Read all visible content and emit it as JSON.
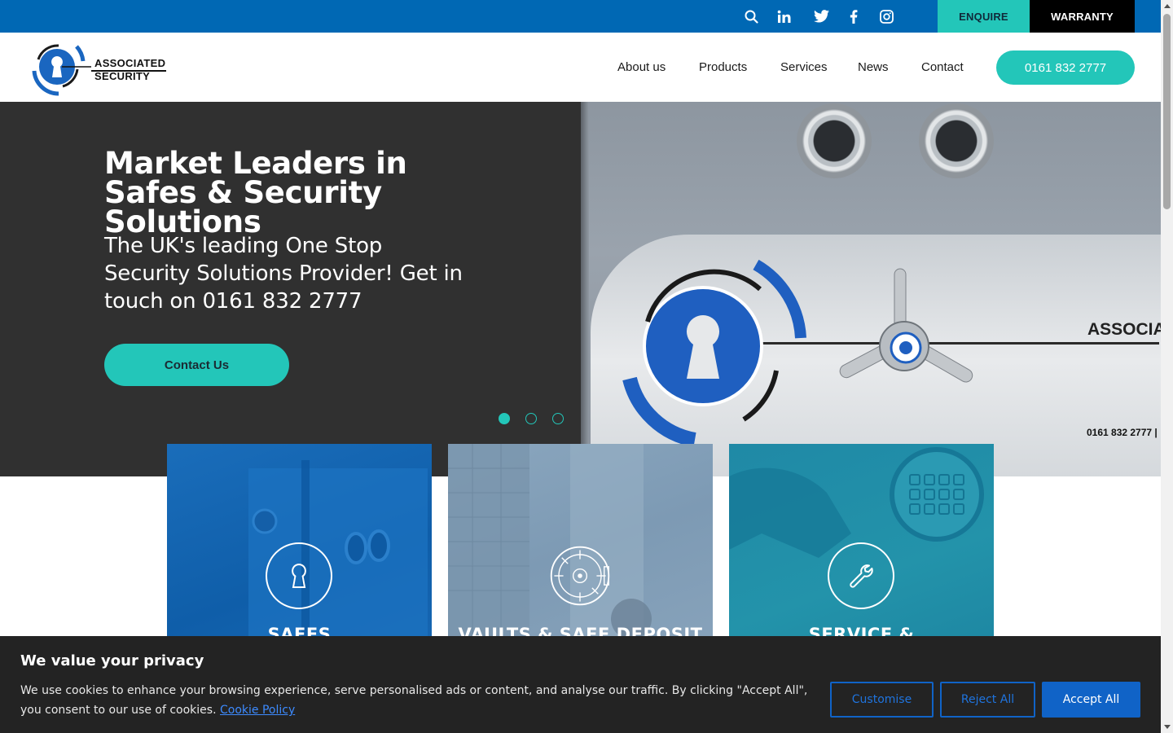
{
  "topbar": {
    "enquire_label": "ENQUIRE",
    "warranty_label": "WARRANTY",
    "icons": [
      "search-icon",
      "linkedin-icon",
      "twitter-icon",
      "facebook-icon",
      "instagram-icon"
    ]
  },
  "logo": {
    "line1": "ASSOCIATED",
    "line2": "SECURITY"
  },
  "nav": {
    "items": [
      {
        "label": "About us"
      },
      {
        "label": "Products"
      },
      {
        "label": "Services"
      },
      {
        "label": "News"
      },
      {
        "label": "Contact"
      }
    ],
    "phone_label": "0161 832 2777"
  },
  "hero": {
    "title": "Market Leaders in Safes & Security Solutions",
    "subtitle": "The UK's leading One Stop Security Solutions Provider! Get in touch on 0161 832 2777",
    "cta_label": "Contact Us",
    "slides_total": 3,
    "active_slide": 1,
    "image_plate_text": "ASSOCIA",
    "image_phone_text": "0161 832 2777  |"
  },
  "cards": [
    {
      "title": "SAFES",
      "icon": "keyhole-icon"
    },
    {
      "title": "VAULTS & SAFE DEPOSIT",
      "icon": "vault-door-icon"
    },
    {
      "title": "SERVICE &",
      "icon": "wrench-icon"
    }
  ],
  "cookie": {
    "title": "We value your privacy",
    "text": "We use cookies to enhance your browsing experience, serve personalised ads or content, and analyse our traffic. By clicking \"Accept All\",  you consent to our use of cookies.",
    "link_label": "Cookie Policy",
    "customise_label": "Customise",
    "reject_label": "Reject All",
    "accept_label": "Accept All"
  },
  "colors": {
    "brand_blue": "#0068b4",
    "accent_teal": "#23c6b9",
    "hero_bg": "#303030",
    "cookie_bg": "#232323",
    "cookie_button_blue": "#1063c7"
  }
}
